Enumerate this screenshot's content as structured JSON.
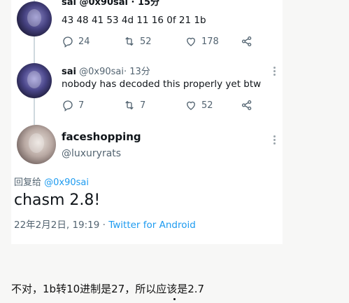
{
  "tweet1": {
    "header_partial": "sai @0x90sai · 15分",
    "body": "43 48 41 53 4d 11 16 0f 21 1b",
    "replies": "24",
    "retweets": "52",
    "likes": "178"
  },
  "tweet2": {
    "name": "sai",
    "handle": "@0x90sai",
    "time": "· 13分",
    "body": "nobody has decoded this properly yet btw",
    "replies": "7",
    "retweets": "7",
    "likes": "52"
  },
  "tweet3": {
    "name": "faceshopping",
    "handle": "@luxuryrats",
    "reply_prefix": "回复给",
    "reply_handle": "@0x90sai",
    "body": "chasm 2.8!",
    "date": "22年2月2日, 19:19",
    "separator": " · ",
    "source": "Twitter for Android"
  },
  "caption": "不对，1b转10进制是27，所以应该是2.7",
  "icons": {
    "reply": "reply-icon",
    "retweet": "retweet-icon",
    "like": "heart-icon",
    "share": "share-icon",
    "more": "more-icon"
  },
  "colors": {
    "link": "#1d9bf0",
    "muted": "#536471",
    "text": "#0f1419"
  }
}
